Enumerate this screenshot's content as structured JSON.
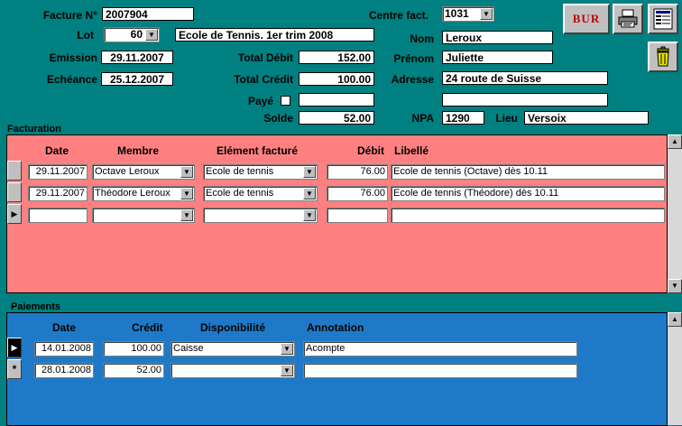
{
  "header": {
    "facture_label": "Facture N°",
    "facture_value": "2007904",
    "lot_label": "Lot",
    "lot_value": "60",
    "lot_desc": "Ecole de Tennis. 1er trim 2008",
    "emission_label": "Emission",
    "emission_value": "29.11.2007",
    "echeance_label": "Echéance",
    "echeance_value": "25.12.2007",
    "total_debit_label": "Total Débit",
    "total_debit_value": "152.00",
    "total_credit_label": "Total Crédit",
    "total_credit_value": "100.00",
    "paye_label": "Payé",
    "paye_value": "",
    "solde_label": "Solde",
    "solde_value": "52.00",
    "centre_label": "Centre fact.",
    "centre_value": "1031",
    "nom_label": "Nom",
    "nom_value": "Leroux",
    "prenom_label": "Prénom",
    "prenom_value": "Juliette",
    "adresse_label": "Adresse",
    "adresse_value": "24 route de Suisse",
    "adresse2_value": "",
    "npa_label": "NPA",
    "npa_value": "1290",
    "lieu_label": "Lieu",
    "lieu_value": "Versoix"
  },
  "toolbar": {
    "bur_label": "BUR"
  },
  "facturation": {
    "title": "Facturation",
    "headers": {
      "date": "Date",
      "membre": "Membre",
      "element": "Elément facturé",
      "debit": "Débit",
      "libelle": "Libellé"
    },
    "rows": [
      {
        "date": "29.11.2007",
        "membre": "Octave Leroux",
        "element": "Ecole de tennis",
        "debit": "76.00",
        "libelle": "Ecole de tennis (Octave) dès 10.11"
      },
      {
        "date": "29.11.2007",
        "membre": "Théodore Leroux",
        "element": "Ecole de tennis",
        "debit": "76.00",
        "libelle": "Ecole de tennis (Théodore) dès 10.11"
      },
      {
        "date": "",
        "membre": "",
        "element": "",
        "debit": "",
        "libelle": ""
      }
    ]
  },
  "paiements": {
    "title": "Paiements",
    "headers": {
      "date": "Date",
      "credit": "Crédit",
      "dispo": "Disponibilité",
      "annotation": "Annotation"
    },
    "rows": [
      {
        "date": "14.01.2008",
        "credit": "100.00",
        "dispo": "Caisse",
        "annotation": "Acompte"
      },
      {
        "date": "28.01.2008",
        "credit": "52.00",
        "dispo": "",
        "annotation": ""
      }
    ]
  },
  "colors": {
    "background": "#008080",
    "facturation": "#ff8080",
    "paiements": "#1e7ac8"
  }
}
